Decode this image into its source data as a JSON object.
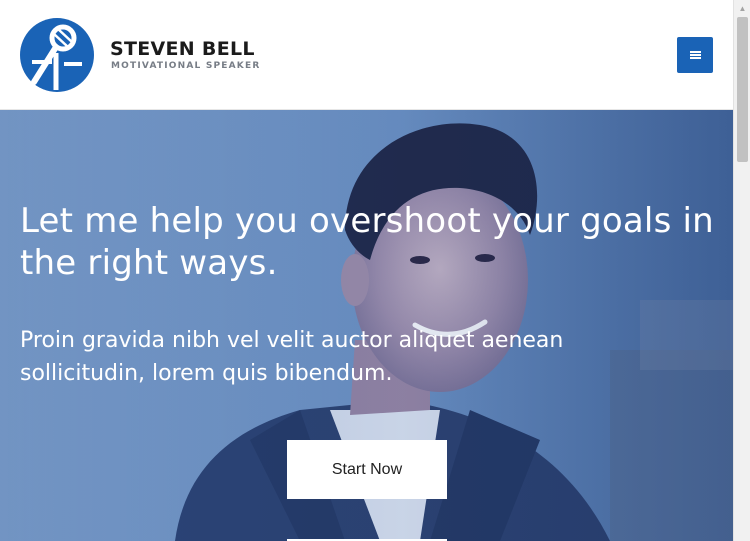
{
  "header": {
    "brand_name": "STEVEN BELL",
    "brand_tagline": "MOTIVATIONAL SPEAKER",
    "logo_icon": "microphone-logo-icon",
    "menu_icon": "hamburger-menu-icon",
    "menu_color": "#1a63b6"
  },
  "hero": {
    "title": "Let me help you overshoot your goals in the right ways.",
    "subtitle": "Proin gravida nibh vel velit auctor aliquet aenean sollicitudin, lorem quis bibendum.",
    "cta_label": "Start Now"
  },
  "colors": {
    "accent": "#1a63b6",
    "hero_tint": "#5e86bb",
    "text_dark": "#1b1b1b",
    "text_muted": "#777d86"
  }
}
